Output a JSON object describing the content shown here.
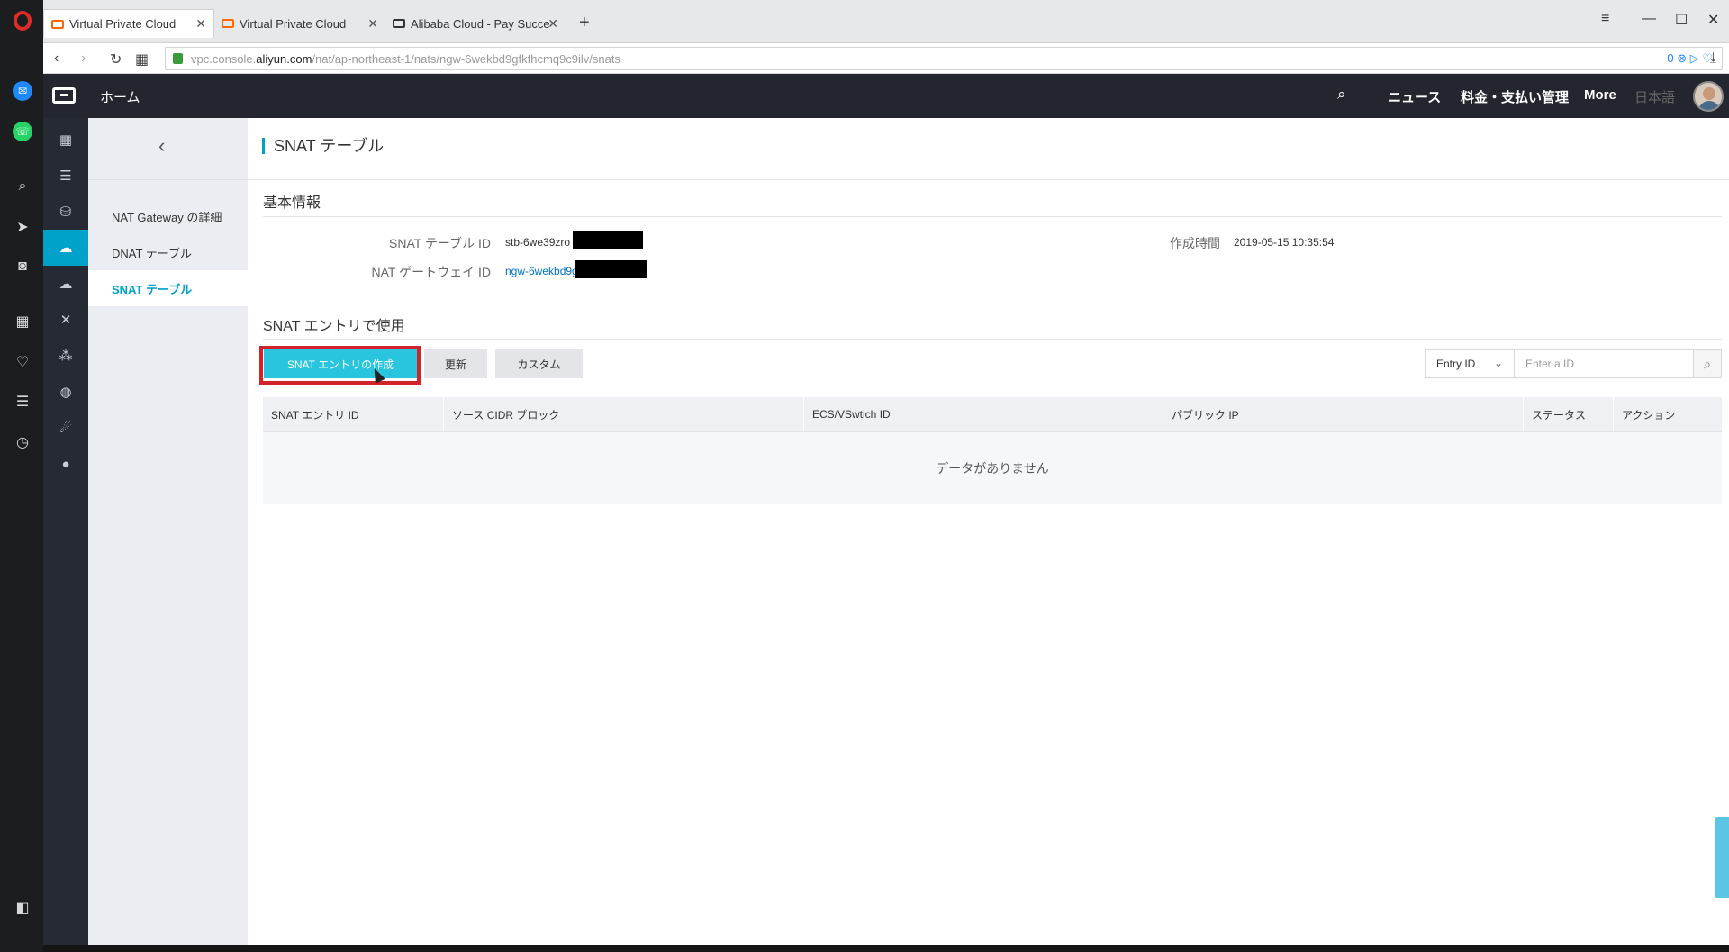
{
  "browser": {
    "tabs": [
      {
        "title": "Virtual Private Cloud",
        "active": true
      },
      {
        "title": "Virtual Private Cloud",
        "active": false
      },
      {
        "title": "Alibaba Cloud - Pay Succe",
        "active": false
      }
    ],
    "new_tab": "+",
    "url_prefix": "vpc.console.",
    "url_host": "aliyun.com",
    "url_path": "/nat/ap-northeast-1/nats/ngw-6wekbd9gfkfhcmq9c9ilv/snats",
    "blocked_count": "0"
  },
  "header": {
    "home": "ホーム",
    "links": [
      "ニュース",
      "料金・支払い管理",
      "More",
      "日本語"
    ]
  },
  "sub_nav": {
    "items": [
      {
        "label": "NAT Gateway の詳細",
        "active": false
      },
      {
        "label": "DNAT テーブル",
        "active": false
      },
      {
        "label": "SNAT テーブル",
        "active": true
      }
    ]
  },
  "page": {
    "title": "SNAT テーブル",
    "basic_info_title": "基本情報",
    "snat_table_id_label": "SNAT テーブル ID",
    "snat_table_id_value": "stb-6we39zro",
    "nat_gateway_id_label": "NAT ゲートウェイ ID",
    "nat_gateway_id_value": "ngw-6wekbd9g",
    "created_label": "作成時間",
    "created_value": "2019-05-15 10:35:54",
    "entries_title": "SNAT エントリで使用",
    "create_button": "SNAT エントリの作成",
    "refresh_button": "更新",
    "custom_button": "カスタム",
    "filter_select": "Entry ID",
    "filter_placeholder": "Enter a ID",
    "columns": [
      "SNAT エントリ ID",
      "ソース CIDR ブロック",
      "ECS/VSwtich ID",
      "パブリック IP",
      "ステータス",
      "アクション"
    ],
    "empty_text": "データがありません"
  }
}
